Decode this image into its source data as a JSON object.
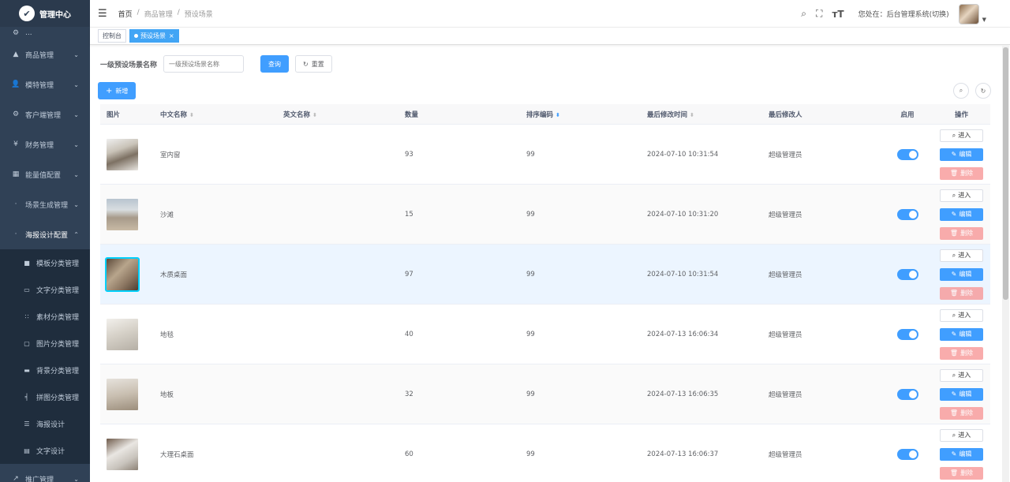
{
  "app": {
    "title": "管理中心"
  },
  "sidebar": {
    "partial_item": "...",
    "items": [
      {
        "label": "商品管理",
        "icon": "tag-icon"
      },
      {
        "label": "模特管理",
        "icon": "user-icon"
      },
      {
        "label": "客户端管理",
        "icon": "gear-icon"
      },
      {
        "label": "财务管理",
        "icon": "yen-icon"
      },
      {
        "label": "能量值配置",
        "icon": "grid-icon"
      },
      {
        "label": "场景生成管理",
        "icon": "dot-icon"
      }
    ],
    "expanded": {
      "label": "海报设计配置",
      "icon": "dot-icon"
    },
    "sub_items": [
      {
        "label": "模板分类管理",
        "icon": "square-icon"
      },
      {
        "label": "文字分类管理",
        "icon": "chat-icon"
      },
      {
        "label": "素材分类管理",
        "icon": "grid-icon"
      },
      {
        "label": "图片分类管理",
        "icon": "image-icon"
      },
      {
        "label": "背景分类管理",
        "icon": "folder-icon"
      },
      {
        "label": "拼图分类管理",
        "icon": "puzzle-icon"
      },
      {
        "label": "海报设计",
        "icon": "sliders-icon"
      },
      {
        "label": "文字设计",
        "icon": "doc-icon"
      }
    ],
    "bottom_item": {
      "label": "推广管理",
      "icon": "share-icon"
    }
  },
  "header": {
    "breadcrumb": [
      "首页",
      "/",
      "商品管理",
      "/",
      "预设场景"
    ],
    "location_label": "您处在：后台管理系统(切换)"
  },
  "tags": {
    "console": "控制台",
    "active": "预设场景"
  },
  "search": {
    "label": "一级预设场景名称",
    "placeholder": "一级预设场景名称",
    "query_label": "查询",
    "reset_label": "重置"
  },
  "toolbar": {
    "add_label": "新增"
  },
  "table": {
    "headers": {
      "image": "图片",
      "cn_name": "中文名称",
      "en_name": "英文名称",
      "quantity": "数量",
      "sort_code": "排序编码",
      "modified_time": "最后修改时间",
      "modified_by": "最后修改人",
      "enabled": "启用",
      "actions": "操作"
    },
    "rows": [
      {
        "cn_name": "室内窗",
        "en_name": "",
        "quantity": "93",
        "sort_code": "99",
        "modified_time": "2024-07-10 10:31:54",
        "modified_by": "超级管理员",
        "enabled": true
      },
      {
        "cn_name": "沙滩",
        "en_name": "",
        "quantity": "15",
        "sort_code": "99",
        "modified_time": "2024-07-10 10:31:20",
        "modified_by": "超级管理员",
        "enabled": true
      },
      {
        "cn_name": "木质桌面",
        "en_name": "",
        "quantity": "97",
        "sort_code": "99",
        "modified_time": "2024-07-10 10:31:54",
        "modified_by": "超级管理员",
        "enabled": true
      },
      {
        "cn_name": "地毯",
        "en_name": "",
        "quantity": "40",
        "sort_code": "99",
        "modified_time": "2024-07-13 16:06:34",
        "modified_by": "超级管理员",
        "enabled": true
      },
      {
        "cn_name": "地板",
        "en_name": "",
        "quantity": "32",
        "sort_code": "99",
        "modified_time": "2024-07-13 16:06:35",
        "modified_by": "超级管理员",
        "enabled": true
      },
      {
        "cn_name": "大理石桌面",
        "en_name": "",
        "quantity": "60",
        "sort_code": "99",
        "modified_time": "2024-07-13 16:06:37",
        "modified_by": "超级管理员",
        "enabled": true
      }
    ],
    "actions": {
      "enter": "进入",
      "edit": "编辑",
      "delete": "删除"
    }
  },
  "colors": {
    "primary": "#409eff",
    "sidebar_bg": "#304156",
    "danger_light": "#f89898"
  }
}
